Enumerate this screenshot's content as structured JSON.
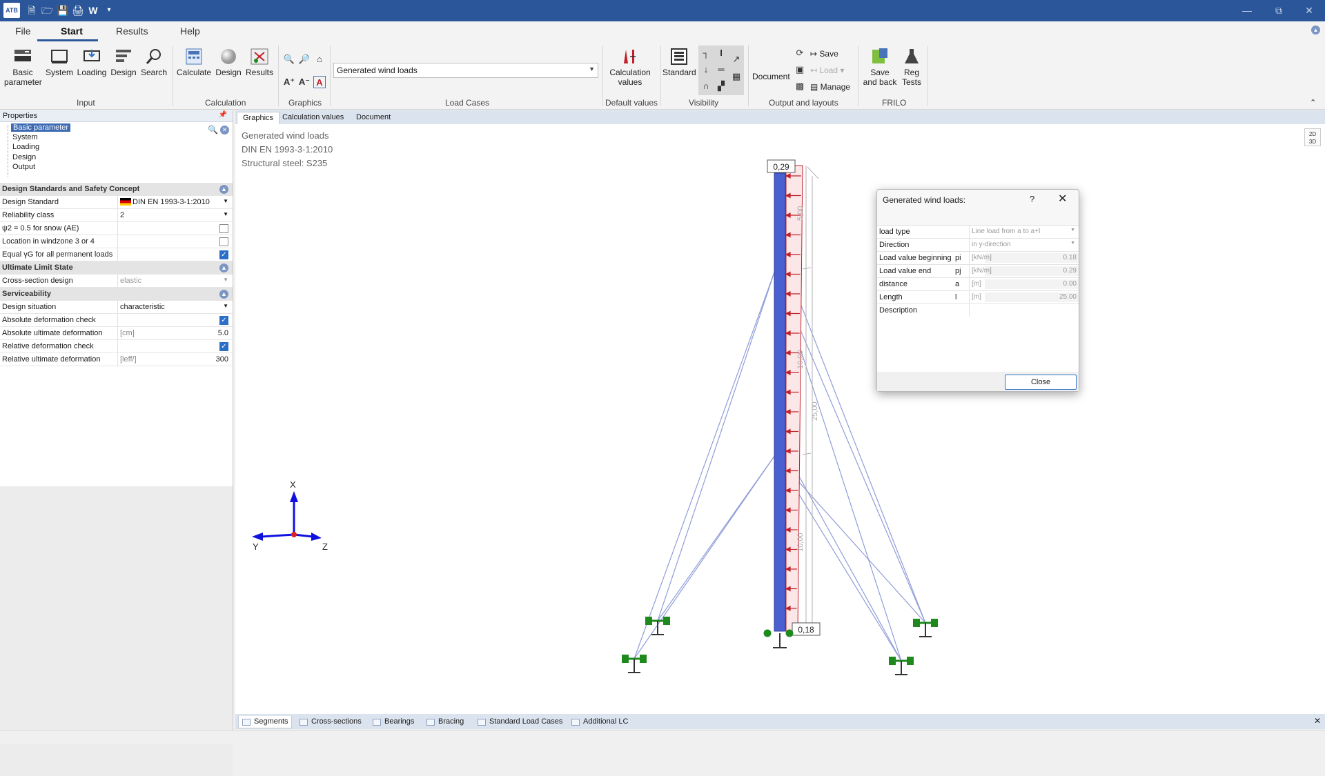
{
  "app": {
    "logo_text": "ATB",
    "quick_access": [
      "new-file-icon",
      "open-folder-icon",
      "save-icon",
      "print-icon",
      "word-export-icon",
      "customize-icon"
    ],
    "word_glyph": "W"
  },
  "menu": {
    "tabs": [
      "File",
      "Start",
      "Results",
      "Help"
    ],
    "active": "Start"
  },
  "ribbon": {
    "input": {
      "label": "Input",
      "buttons": [
        "Basic\nparameter",
        "System",
        "Loading",
        "Design",
        "Search"
      ]
    },
    "calculation": {
      "label": "Calculation",
      "buttons": [
        "Calculate",
        "Design",
        "Results"
      ]
    },
    "graphics": {
      "label": "Graphics"
    },
    "load_cases": {
      "label": "Load Cases",
      "selected": "Generated wind loads"
    },
    "default_values": {
      "label": "Default values",
      "button": "Calculation\nvalues"
    },
    "visibility": {
      "label": "Visibility",
      "button": "Standard"
    },
    "output": {
      "label": "Output and layouts",
      "document": "Document",
      "save": "Save",
      "load": "Load",
      "manage": "Manage"
    },
    "frilo": {
      "label": "FRILO",
      "save_back": "Save\nand back",
      "reg_tests": "Reg\nTests"
    }
  },
  "properties": {
    "header": "Properties",
    "tree": [
      "Basic parameter",
      "System",
      "Loading",
      "Design",
      "Output"
    ],
    "sections": {
      "design_standards": {
        "title": "Design Standards and Safety Concept",
        "design_standard": {
          "label": "Design Standard",
          "value": "DIN EN 1993-3-1:2010"
        },
        "reliability_class": {
          "label": "Reliability class",
          "value": "2"
        },
        "psi2": {
          "label": "ψ2 = 0.5 for snow (AE)",
          "checked": false
        },
        "windzone": {
          "label": "Location in windzone 3 or 4",
          "checked": false
        },
        "equal_yg": {
          "label": "Equal γG for all permanent loads",
          "checked": true
        }
      },
      "uls": {
        "title": "Ultimate Limit State",
        "cross_section": {
          "label": "Cross-section design",
          "value": "elastic"
        }
      },
      "sls": {
        "title": "Serviceability",
        "design_situation": {
          "label": "Design situation",
          "value": "characteristic"
        },
        "abs_check": {
          "label": "Absolute deformation check",
          "checked": true
        },
        "abs_ult": {
          "label": "Absolute ultimate deformation",
          "unit": "[cm]",
          "value": "5.0"
        },
        "rel_check": {
          "label": "Relative deformation check",
          "checked": true
        },
        "rel_ult": {
          "label": "Relative ultimate deformation",
          "unit": "[leff/]",
          "value": "300"
        }
      }
    }
  },
  "main_tabs": [
    "Graphics",
    "Calculation values",
    "Document"
  ],
  "graphic": {
    "info": [
      "Generated wind loads",
      "DIN EN 1993-3-1:2010",
      "Structural steel: S235"
    ],
    "top_value": "0,29",
    "bottom_value": "0,18",
    "dim_labels": [
      "5,00",
      "10,00",
      "10,00",
      "25,00"
    ],
    "axes": {
      "x": "X",
      "y": "Y",
      "z": "Z"
    },
    "view_toggle": [
      "2D",
      "3D"
    ],
    "colors": {
      "mast": "#4a5fd0",
      "load": "#c0202a",
      "support": "#1e8a1e",
      "cable": "#8f9cd8"
    }
  },
  "dialog": {
    "title": "Generated wind loads:",
    "help": "?",
    "rows": [
      {
        "label": "load type",
        "sym": "",
        "unit": "",
        "value": "Line load from a to a+l",
        "dropdown": true
      },
      {
        "label": "Direction",
        "sym": "",
        "unit": "",
        "value": "in y-direction",
        "dropdown": true
      },
      {
        "label": "Load value beginning",
        "sym": "pi",
        "unit": "[kN/m]",
        "value": "0.18"
      },
      {
        "label": "Load value end",
        "sym": "pj",
        "unit": "[kN/m]",
        "value": "0.29"
      },
      {
        "label": "distance",
        "sym": "a",
        "unit": "[m]",
        "value": "0.00"
      },
      {
        "label": "Length",
        "sym": "l",
        "unit": "[m]",
        "value": "25.00"
      },
      {
        "label": "Description",
        "sym": "",
        "unit": "",
        "value": ""
      }
    ],
    "close_button": "Close"
  },
  "bottom_tabs": [
    "Segments",
    "Cross-sections",
    "Bearings",
    "Bracing",
    "Standard Load Cases",
    "Additional LC"
  ]
}
